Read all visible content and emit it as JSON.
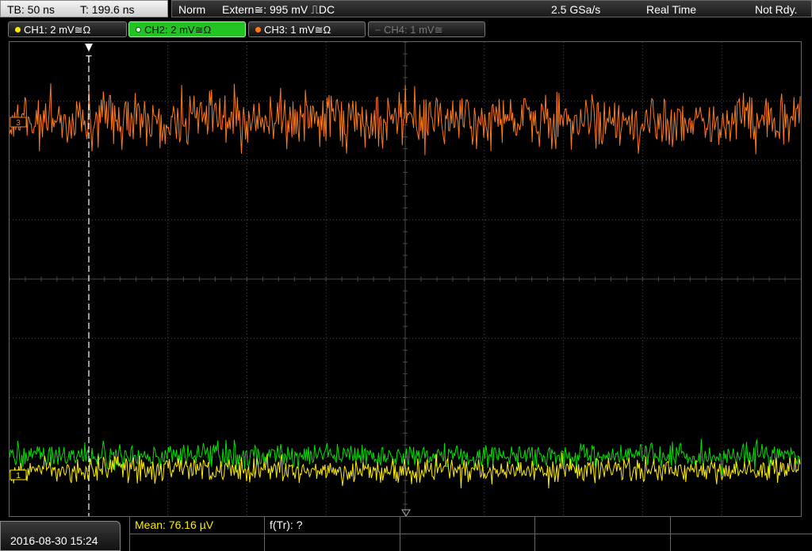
{
  "header": {
    "timebase": "TB: 50 ns",
    "trigger_time": "T: 199.6 ns",
    "mode": "Norm",
    "trigger_source": "Extern≅: 995 mV ⎍DC",
    "sample_rate": "2.5 GSa/s",
    "acq_mode": "Real Time",
    "status": "Not Rdy."
  },
  "channels": [
    {
      "label": "CH1: 2 mV≅Ω",
      "color": "#ffee00",
      "state": "on"
    },
    {
      "label": "CH2: 2 mV≅Ω",
      "color": "#00e000",
      "state": "active"
    },
    {
      "label": "CH3: 1 mV≅Ω",
      "color": "#ff7a1a",
      "state": "on"
    },
    {
      "label": "CH4: 1 mV≅",
      "color": "#777777",
      "state": "off"
    }
  ],
  "markers": {
    "trigger": "T",
    "ch3_ref": "3",
    "ch1_ref": "1"
  },
  "footer": {
    "date": "2016-08-30 15:24",
    "measurement_1": "Mean: 76.16 µV",
    "measurement_2": "f(Tr): ?"
  },
  "colors": {
    "grid": "#4a4a4a",
    "ch1": "#ffee00",
    "ch2": "#00e000",
    "ch3": "#ff7a1a",
    "trigger_line": "#ffffff"
  }
}
